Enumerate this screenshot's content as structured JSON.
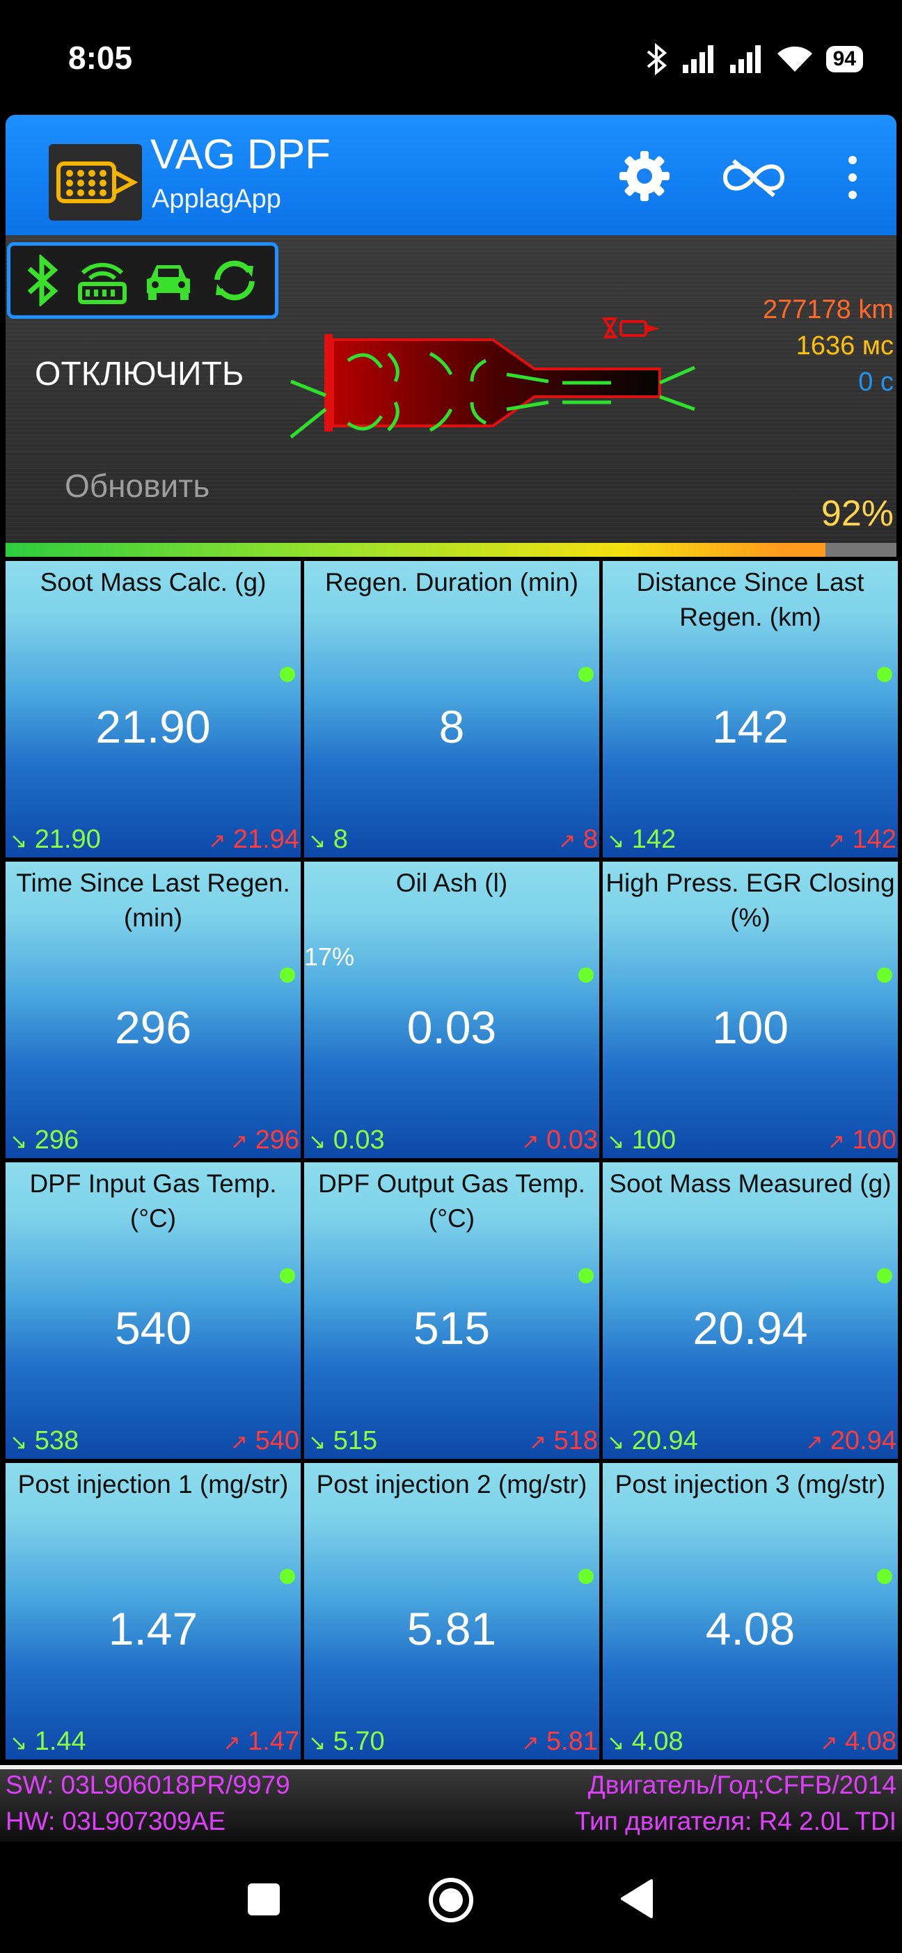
{
  "status_bar": {
    "time": "8:05",
    "battery": "94"
  },
  "app": {
    "title": "VAG DPF",
    "subtitle": "ApplagApp"
  },
  "panel": {
    "disconnect_label": "ОТКЛЮЧИТЬ",
    "refresh_label": "Обновить",
    "odometer": "277178 km",
    "time_ms": "1636 мс",
    "time_s": "0 с",
    "load_percent_text": "92%",
    "load_fraction": 0.92
  },
  "colors": {
    "accent": "#1e90ff",
    "min_value": "#8aff42",
    "max_value": "#ff3b3b",
    "info_text": "#e040fb"
  },
  "tiles": [
    {
      "title": "Soot Mass Calc. (g)",
      "value": "21.90",
      "min": "21.90",
      "max": "21.94"
    },
    {
      "title": "Regen. Duration (min)",
      "value": "8",
      "min": "8",
      "max": "8"
    },
    {
      "title": "Distance Since Last Regen. (km)",
      "value": "142",
      "min": "142",
      "max": "142"
    },
    {
      "title": "Time Since Last Regen. (min)",
      "value": "296",
      "min": "296",
      "max": "296"
    },
    {
      "title": "Oil Ash (l)",
      "value": "0.03",
      "min": "0.03",
      "max": "0.03",
      "extra": "17%"
    },
    {
      "title": "High Press. EGR Closing (%)",
      "value": "100",
      "min": "100",
      "max": "100"
    },
    {
      "title": "DPF Input Gas Temp. (°C)",
      "value": "540",
      "min": "538",
      "max": "540"
    },
    {
      "title": "DPF Output Gas Temp. (°C)",
      "value": "515",
      "min": "515",
      "max": "518"
    },
    {
      "title": "Soot Mass Measured (g)",
      "value": "20.94",
      "min": "20.94",
      "max": "20.94"
    },
    {
      "title": "Post injection 1 (mg/str)",
      "value": "1.47",
      "min": "1.44",
      "max": "1.47"
    },
    {
      "title": "Post injection 2 (mg/str)",
      "value": "5.81",
      "min": "5.70",
      "max": "5.81"
    },
    {
      "title": "Post injection 3 (mg/str)",
      "value": "4.08",
      "min": "4.08",
      "max": "4.08"
    }
  ],
  "info": {
    "sw": "SW: 03L906018PR/9979",
    "hw": "HW: 03L907309AE",
    "engine_year": "Двигатель/Год:CFFB/2014",
    "engine_type": "Тип двигателя: R4 2.0L TDI"
  },
  "icons": [
    "bluetooth-icon",
    "wifi-icon",
    "signal-icon",
    "settings-gear-icon",
    "loop-off-icon",
    "more-vert-icon",
    "obd-adapter-icon",
    "car-icon",
    "sync-icon",
    "dpf-filter-icon",
    "warning-sensor-icon",
    "nav-recents-icon",
    "nav-home-icon",
    "nav-back-icon"
  ]
}
